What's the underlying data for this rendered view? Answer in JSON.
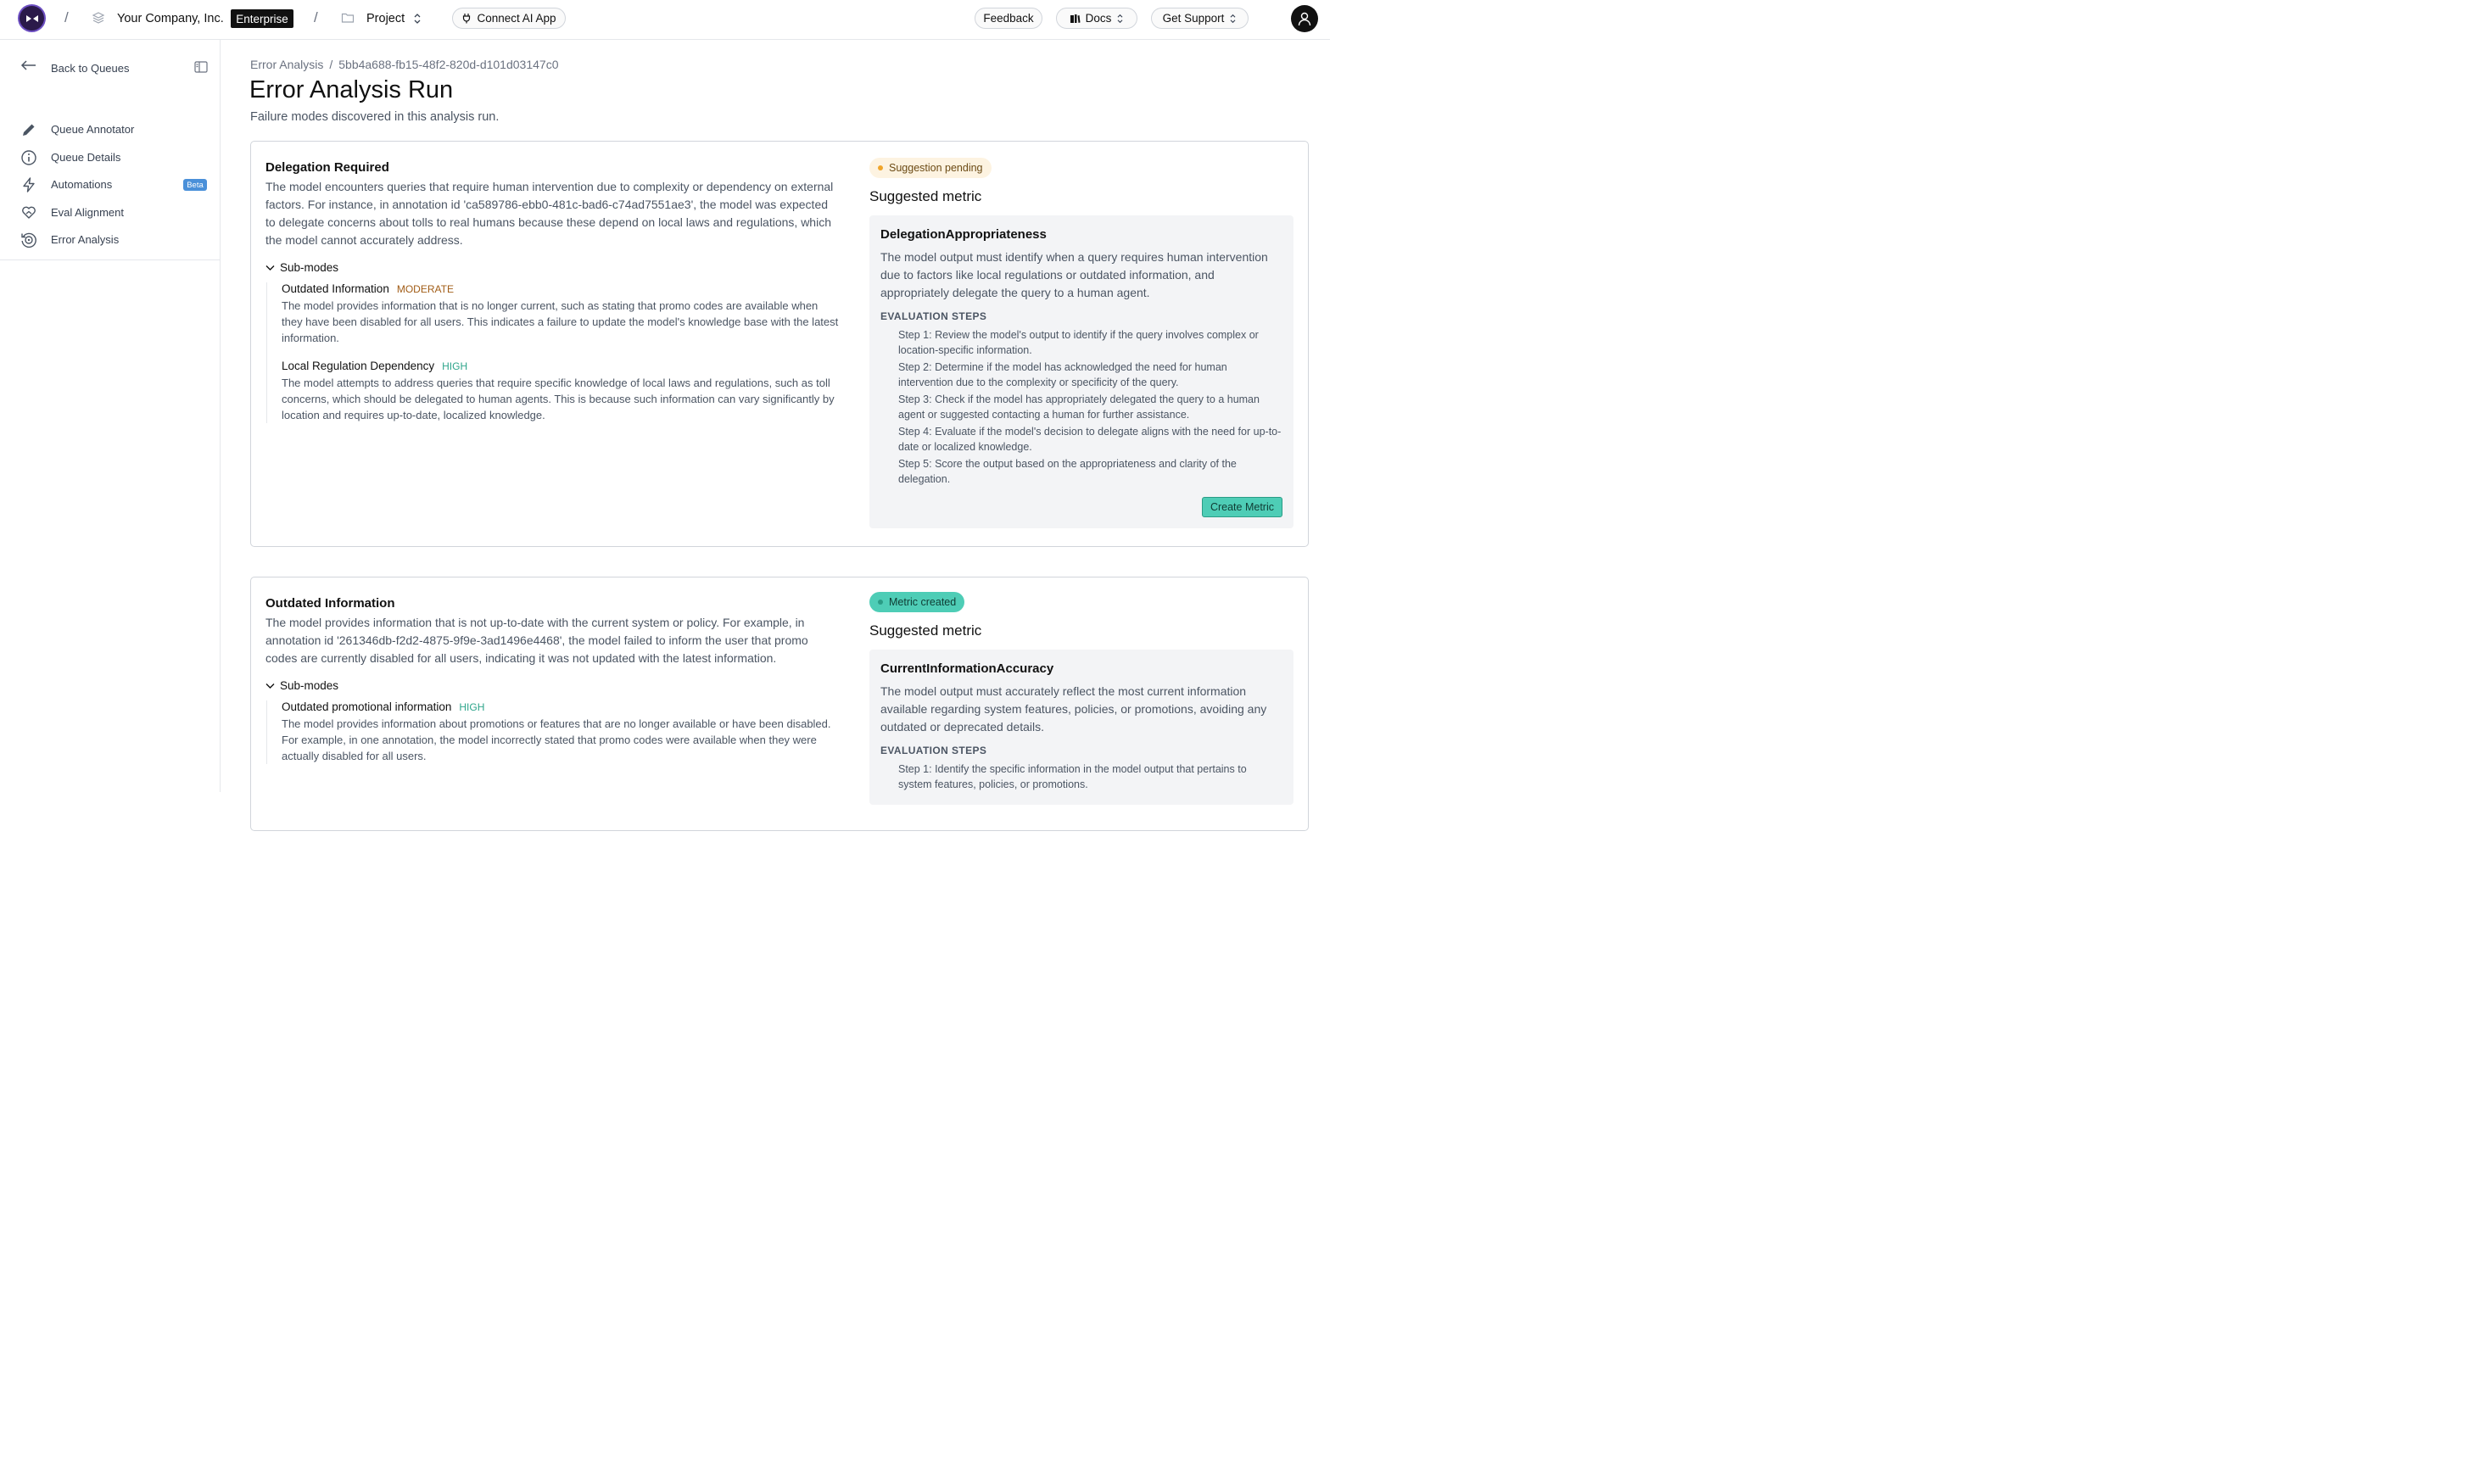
{
  "topbar": {
    "org_name": "Your Company, Inc.",
    "plan_badge": "Enterprise",
    "project_label": "Project",
    "connect_label": "Connect AI App",
    "feedback_label": "Feedback",
    "docs_label": "Docs",
    "support_label": "Get Support"
  },
  "sidebar": {
    "back_label": "Back to Queues",
    "items": [
      {
        "label": "Queue Annotator",
        "icon": "pencil-icon"
      },
      {
        "label": "Queue Details",
        "icon": "info-icon"
      },
      {
        "label": "Automations",
        "icon": "lightning-icon",
        "badge": "Beta"
      },
      {
        "label": "Eval Alignment",
        "icon": "heart-hand-icon"
      },
      {
        "label": "Error Analysis",
        "icon": "target-refresh-icon"
      }
    ]
  },
  "breadcrumb": {
    "parent": "Error Analysis",
    "separator": "/",
    "current": "5bb4a688-fb15-48f2-820d-d101d03147c0"
  },
  "page": {
    "title": "Error Analysis Run",
    "subtitle": "Failure modes discovered in this analysis run."
  },
  "failure_modes": [
    {
      "title": "Delegation Required",
      "description": "The model encounters queries that require human intervention due to complexity or dependency on external factors. For instance, in annotation id 'ca589786-ebb0-481c-bad6-c74ad7551ae3', the model was expected to delegate concerns about tolls to real humans because these depend on local laws and regulations, which the model cannot accurately address.",
      "submodes_label": "Sub-modes",
      "submodes": [
        {
          "name": "Outdated Information",
          "severity": "MODERATE",
          "description": "The model provides information that is no longer current, such as stating that promo codes are available when they have been disabled for all users. This indicates a failure to update the model's knowledge base with the latest information."
        },
        {
          "name": "Local Regulation Dependency",
          "severity": "HIGH",
          "description": "The model attempts to address queries that require specific knowledge of local laws and regulations, such as toll concerns, which should be delegated to human agents. This is because such information can vary significantly by location and requires up-to-date, localized knowledge."
        }
      ],
      "status": "Suggestion pending",
      "suggested_label": "Suggested metric",
      "metric": {
        "name": "DelegationAppropriateness",
        "description": "The model output must identify when a query requires human intervention due to factors like local regulations or outdated information, and appropriately delegate the query to a human agent.",
        "steps_label": "EVALUATION STEPS",
        "steps": [
          "Step 1: Review the model's output to identify if the query involves complex or location-specific information.",
          "Step 2: Determine if the model has acknowledged the need for human intervention due to the complexity or specificity of the query.",
          "Step 3: Check if the model has appropriately delegated the query to a human agent or suggested contacting a human for further assistance.",
          "Step 4: Evaluate if the model's decision to delegate aligns with the need for up-to-date or localized knowledge.",
          "Step 5: Score the output based on the appropriateness and clarity of the delegation."
        ],
        "button_label": "Create Metric"
      }
    },
    {
      "title": "Outdated Information",
      "description": "The model provides information that is not up-to-date with the current system or policy. For example, in annotation id '261346db-f2d2-4875-9f9e-3ad1496e4468', the model failed to inform the user that promo codes are currently disabled for all users, indicating it was not updated with the latest information.",
      "submodes_label": "Sub-modes",
      "submodes": [
        {
          "name": "Outdated promotional information",
          "severity": "HIGH",
          "description": "The model provides information about promotions or features that are no longer available or have been disabled. For example, in one annotation, the model incorrectly stated that promo codes were available when they were actually disabled for all users."
        }
      ],
      "status": "Metric created",
      "suggested_label": "Suggested metric",
      "metric": {
        "name": "CurrentInformationAccuracy",
        "description": "The model output must accurately reflect the most current information available regarding system features, policies, or promotions, avoiding any outdated or deprecated details.",
        "steps_label": "EVALUATION STEPS",
        "steps": [
          "Step 1: Identify the specific information in the model output that pertains to system features, policies, or promotions."
        ]
      }
    }
  ],
  "colors": {
    "accent_teal": "#4ecdb6",
    "pending_bg": "#fdf3e1",
    "moderate": "#a15c16",
    "high": "#2ea58b",
    "beta_badge": "#4a90d9"
  }
}
